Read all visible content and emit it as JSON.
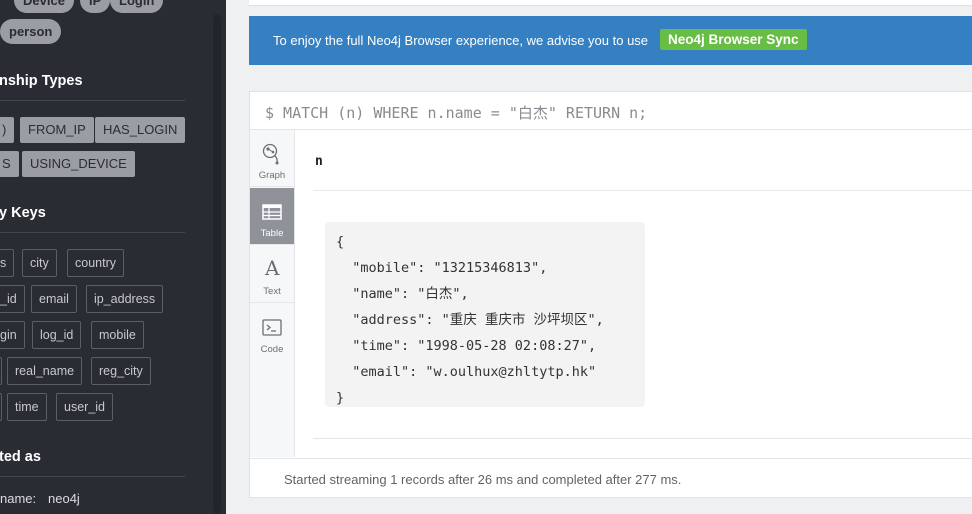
{
  "sidebar": {
    "node_labels": [
      "Device",
      "IP",
      "Login",
      "person"
    ],
    "relationship_types_title": "nship Types",
    "relationship_types": [
      ")",
      "FROM_IP",
      "HAS_LOGIN",
      "S",
      "USING_DEVICE"
    ],
    "property_keys_title": "y Keys",
    "property_keys": [
      "s",
      "city",
      "country",
      "_id",
      "email",
      "ip_address",
      "gin",
      "log_id",
      "mobile",
      "",
      "real_name",
      "reg_city",
      "",
      "time",
      "user_id"
    ],
    "connected_title": "ted as",
    "username_label": "name:",
    "username_value": "neo4j"
  },
  "banner": {
    "text": "To enjoy the full Neo4j Browser experience, we advise you to use",
    "button_label": "Neo4j Browser Sync",
    "background_color": "#3580c3",
    "button_color": "#68bd45"
  },
  "frame": {
    "query": "$ MATCH (n) WHERE n.name = \"白杰\" RETURN n;",
    "views": [
      {
        "label": "Graph",
        "icon": "graph-icon",
        "active": false
      },
      {
        "label": "Table",
        "icon": "table-icon",
        "active": true
      },
      {
        "label": "Text",
        "icon": "text-icon",
        "active": false
      },
      {
        "label": "Code",
        "icon": "code-icon",
        "active": false
      }
    ],
    "column_header": "n",
    "result_lines": [
      "{",
      "  \"mobile\": \"13215346813\",",
      "  \"name\": \"白杰\",",
      "  \"address\": \"重庆 重庆市 沙坪坝区\",",
      "  \"time\": \"1998-05-28 02:08:27\",",
      "  \"email\": \"w.oulhux@zhltytp.hk\"",
      "}"
    ],
    "status": "Started streaming 1 records after 26 ms and completed after 277 ms."
  }
}
